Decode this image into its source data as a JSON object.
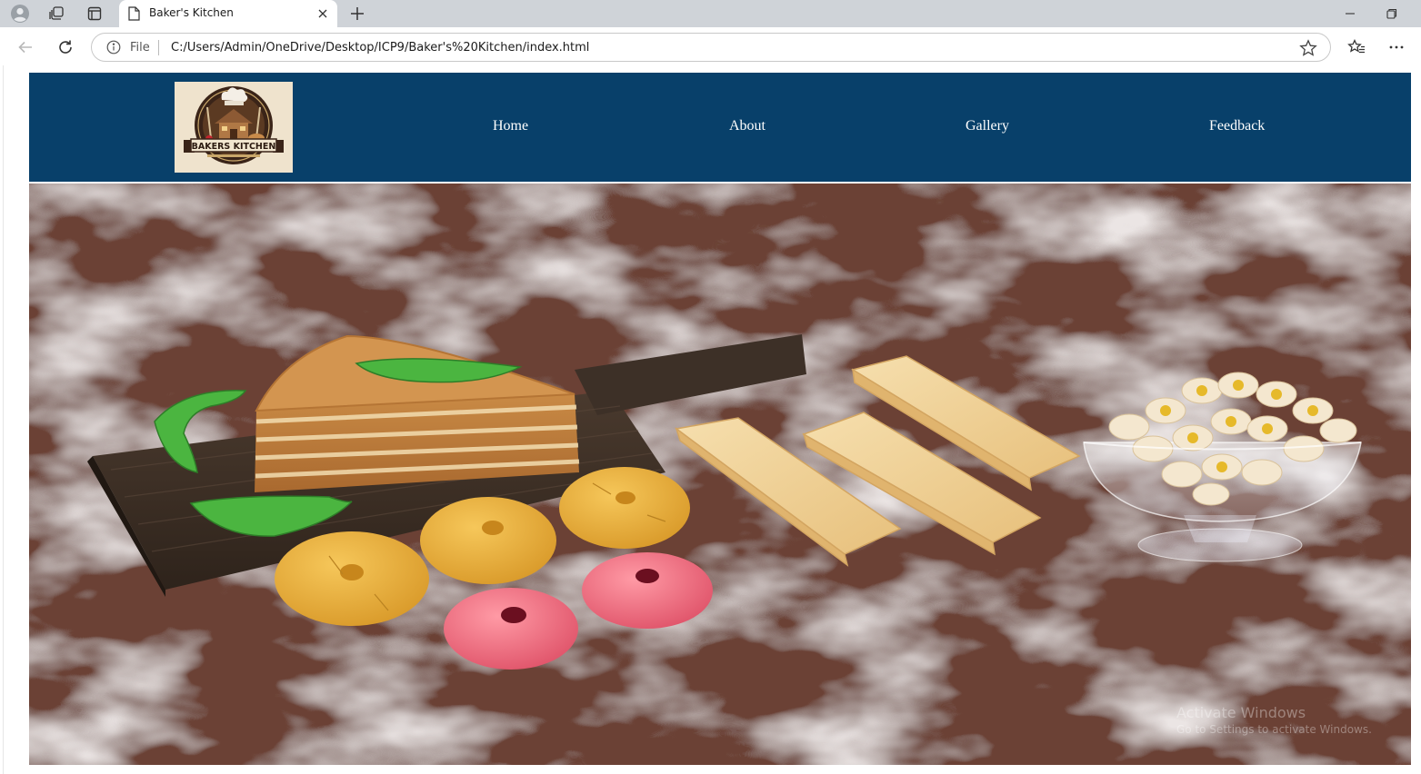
{
  "browser": {
    "tab_title": "Baker's Kitchen",
    "address_scheme": "File",
    "url": "C:/Users/Admin/OneDrive/Desktop/ICP9/Baker's%20Kitchen/index.html"
  },
  "header": {
    "logo_text": "BAKERS KITCHEN",
    "bg_color": "#08406a",
    "nav": [
      {
        "label": "Home"
      },
      {
        "label": "About"
      },
      {
        "label": "Gallery"
      },
      {
        "label": "Feedback"
      }
    ]
  },
  "watermark": {
    "line1": "Activate Windows",
    "line2": "Go to Settings to activate Windows."
  }
}
